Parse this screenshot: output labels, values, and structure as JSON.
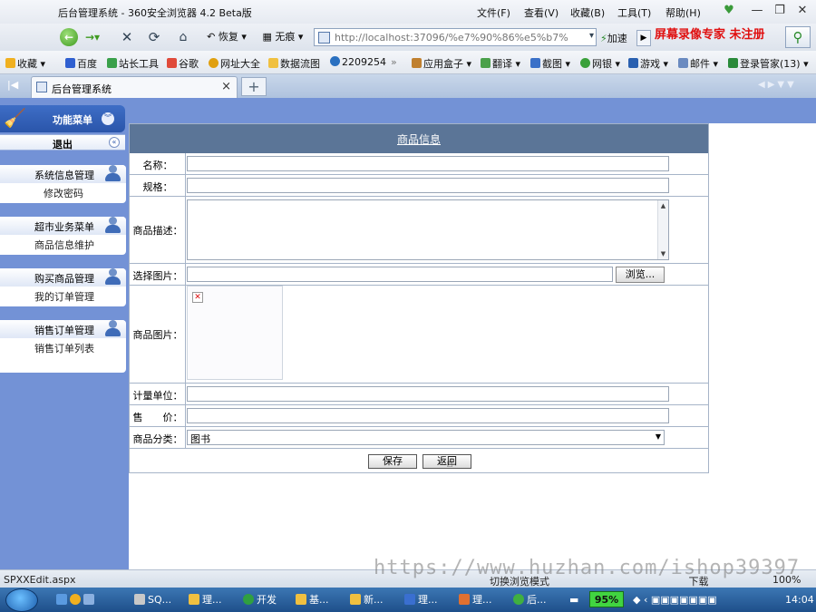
{
  "window": {
    "title": "后台管理系统 - 360安全浏览器 4.2 Beta版",
    "menu": [
      "文件(F)",
      "查看(V)",
      "收藏(B)",
      "工具(T)",
      "帮助(H)"
    ],
    "controls": [
      "—",
      "❐",
      "✕"
    ]
  },
  "toolbar": {
    "restore_label": "恢复",
    "notrace_label": "无痕",
    "address": "http://localhost:37096/%e7%90%86%e5%b7%",
    "accelerate_label": "加速",
    "watermark": "屏幕录像专家 未注册"
  },
  "favorites": [
    "收藏",
    "百度",
    "站长工具",
    "谷歌",
    "网址大全",
    "数据流图",
    "2209254",
    "»",
    "应用盒子",
    "翻译",
    "截图",
    "网银",
    "游戏",
    "邮件",
    "登录管家(13)"
  ],
  "tab": {
    "label": "后台管理系统",
    "close": "×",
    "add": "+"
  },
  "sidebar": {
    "title": "功能菜单",
    "exit_label": "退出",
    "groups": [
      {
        "title": "系统信息管理",
        "link": "修改密码"
      },
      {
        "title": "超市业务菜单",
        "link": "商品信息维护"
      },
      {
        "title": "购买商品管理",
        "link": "我的订单管理"
      },
      {
        "title": "销售订单管理",
        "link": "销售订单列表"
      }
    ]
  },
  "form": {
    "title": "商品信息",
    "name_label": "名称：",
    "spec_label": "规格：",
    "desc_label": "商品描述：",
    "choose_image_label": "选择图片：",
    "browse_label": "浏览...",
    "image_label": "商品图片：",
    "unit_label": "计量单位：",
    "price_label": "售　　价：",
    "category_label": "商品分类：",
    "category_value": "图书",
    "save_label": "保存",
    "return_label": "返回"
  },
  "status": {
    "text": "SPXXEdit.aspx",
    "mode": "切换浏览模式",
    "download": "下载",
    "zoom": "100%",
    "url_watermark": "https://www.huzhan.com/ishop39397"
  },
  "taskbar": {
    "items": [
      "SQ...",
      "理...",
      "开发",
      "基...",
      "新...",
      "理...",
      "理...",
      "后..."
    ],
    "memory": "95%",
    "clock": "14:04"
  }
}
